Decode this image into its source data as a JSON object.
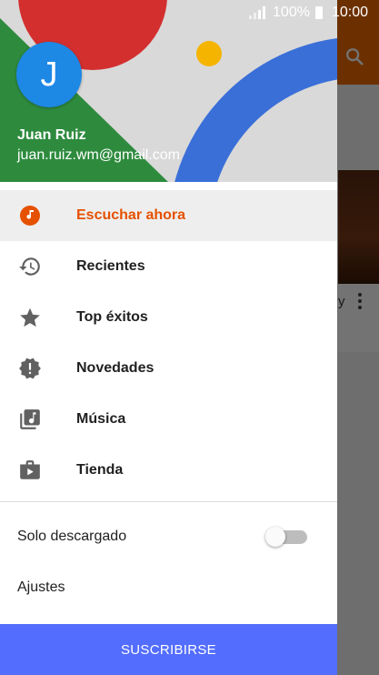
{
  "status_bar": {
    "battery": "100%",
    "time": "10:00"
  },
  "background": {
    "card_title": "y",
    "search_icon": "search-icon"
  },
  "drawer": {
    "user": {
      "initial": "J",
      "name": "Juan Ruiz",
      "email": "juan.ruiz.wm@gmail.com"
    },
    "menu": [
      {
        "label": "Escuchar ahora",
        "icon": "listen-now-icon",
        "active": true
      },
      {
        "label": "Recientes",
        "icon": "history-icon",
        "active": false
      },
      {
        "label": "Top éxitos",
        "icon": "star-icon",
        "active": false
      },
      {
        "label": "Novedades",
        "icon": "new-releases-icon",
        "active": false
      },
      {
        "label": "Música",
        "icon": "library-music-icon",
        "active": false
      },
      {
        "label": "Tienda",
        "icon": "shop-icon",
        "active": false
      }
    ],
    "settings": {
      "offline_label": "Solo descargado",
      "offline_enabled": false,
      "settings_label": "Ajustes"
    },
    "subscribe_label": "SUSCRIBIRSE"
  },
  "colors": {
    "accent": "#e65100",
    "toolbar": "#ef6c00",
    "subscribe": "#536dfe",
    "avatar": "#1e88e5",
    "header_green": "#2e8b3e",
    "header_red": "#d32f2f",
    "header_blue": "#3a6fd8",
    "header_yellow": "#f5b400"
  }
}
